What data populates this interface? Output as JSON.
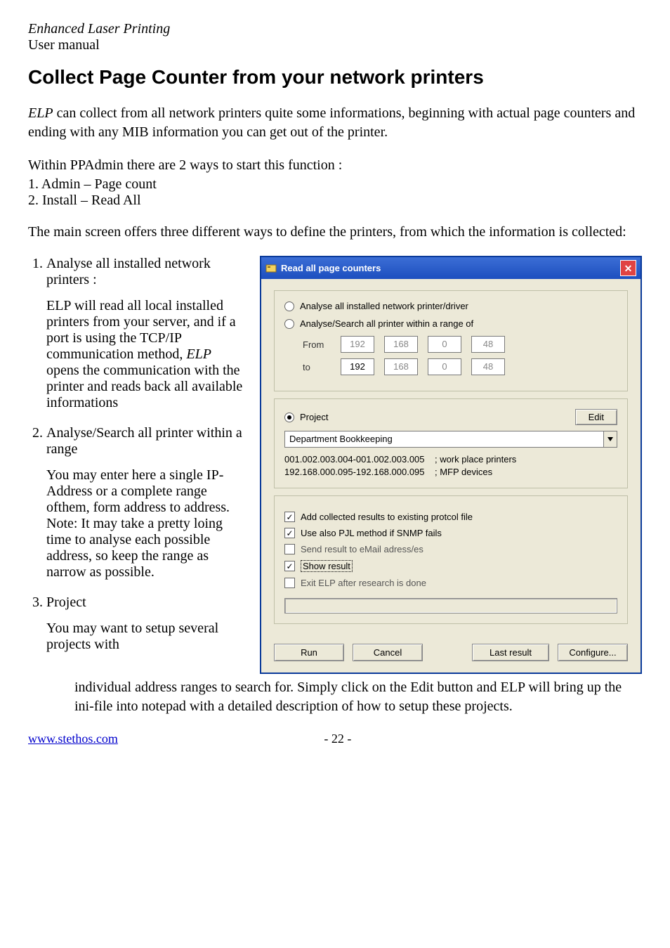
{
  "header": {
    "title": "Enhanced Laser Printing",
    "subtitle": "User manual"
  },
  "heading": "Collect Page Counter from your network printers",
  "para_intro_1": "ELP",
  "para_intro_2": " can collect from all network printers quite some informations, beginning with actual page counters and ending with any MIB information you can get out of the printer.",
  "para_within": "Within PPAdmin there are 2 ways to start this function :",
  "ways": {
    "w1": "1. Admin – Page count",
    "w2": "2. Install – Read All"
  },
  "para_main": "The main screen offers three different ways to define the printers, from which the information is collected:",
  "items": {
    "1": {
      "title": "Analyse all installed network printers :",
      "body1a": "ELP will read all local installed printers from your server, and if a port is using the TCP/IP communication method, ",
      "body1b": "ELP",
      "body1c": " opens the communication with the printer and reads back all available informations"
    },
    "2": {
      "title": "Analyse/Search all printer within a range",
      "body1": "You may enter here a single IP-Address or a complete range ofthem, form address to address.",
      "body2": "Note: It may take a pretty loing time to analyse each possible address, so keep the range as narrow as possible."
    },
    "3": {
      "title": "Project",
      "body1": "You may want to setup several projects with"
    }
  },
  "para_after": "individual address ranges to search for. Simply click on the Edit button and ELP will bring up the ini-file into notepad with a detailed description of how to setup these projects.",
  "footer": {
    "link": "www.stethos.com",
    "page": "- 22 -"
  },
  "dialog": {
    "title": "Read all page counters",
    "radio1": "Analyse all installed network printer/driver",
    "radio2": "Analyse/Search all printer within a range of",
    "from_label": "From",
    "to_label": "to",
    "from_ip": {
      "a": "192",
      "b": "168",
      "c": "0",
      "d": "48"
    },
    "to_ip": {
      "a": "192",
      "b": "168",
      "c": "0",
      "d": "48"
    },
    "radio3": "Project",
    "edit_btn": "Edit",
    "combo": "Department Bookkeeping",
    "proj_line1": "001.002.003.004-001.002.003.005    ; work place printers",
    "proj_line2": "192.168.000.095-192.168.000.095    ; MFP devices",
    "chk1": "Add collected results to existing protcol file",
    "chk2": "Use also PJL method if SNMP fails",
    "chk3": "Send result to eMail adress/es",
    "chk4": "Show result",
    "chk5": "Exit ELP after research is done",
    "btn_run": "Run",
    "btn_cancel": "Cancel",
    "btn_last": "Last result",
    "btn_conf": "Configure..."
  }
}
